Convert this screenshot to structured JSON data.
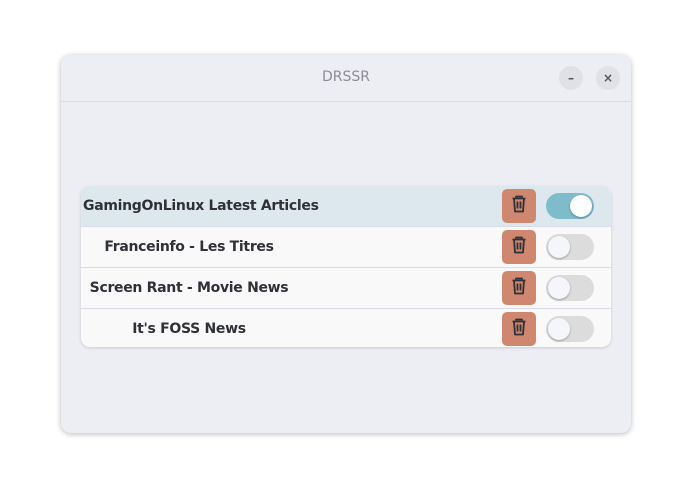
{
  "window": {
    "title": "DRSSR",
    "minimize_label": "–",
    "close_label": "×"
  },
  "feeds": [
    {
      "name": "GamingOnLinux Latest Articles",
      "enabled": true,
      "selected": true
    },
    {
      "name": "Franceinfo - Les Titres",
      "enabled": false,
      "selected": false
    },
    {
      "name": "Screen Rant - Movie News",
      "enabled": false,
      "selected": false
    },
    {
      "name": "It's FOSS News",
      "enabled": false,
      "selected": false
    }
  ],
  "colors": {
    "accent": "#7fbccb",
    "delete": "#cf876f"
  }
}
